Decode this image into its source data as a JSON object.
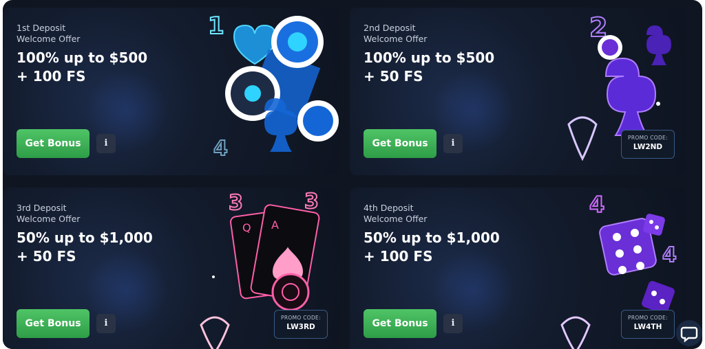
{
  "cards": [
    {
      "subtitle_line1": "1st Deposit",
      "subtitle_line2": "Welcome Offer",
      "offer_line1": "100% up to $500",
      "offer_line2": "+ 100 FS",
      "button": "Get Bonus",
      "info": "i"
    },
    {
      "subtitle_line1": "2nd Deposit",
      "subtitle_line2": "Welcome Offer",
      "offer_line1": "100% up to $500",
      "offer_line2": "+ 50 FS",
      "button": "Get Bonus",
      "info": "i",
      "promo_label": "PROMO CODE:",
      "promo_code": "LW2ND"
    },
    {
      "subtitle_line1": "3rd Deposit",
      "subtitle_line2": "Welcome Offer",
      "offer_line1": "50% up to $1,000",
      "offer_line2": "+ 50 FS",
      "button": "Get Bonus",
      "info": "i",
      "promo_label": "PROMO CODE:",
      "promo_code": "LW3RD"
    },
    {
      "subtitle_line1": "4th Deposit",
      "subtitle_line2": "Welcome Offer",
      "offer_line1": "50% up to $1,000",
      "offer_line2": "+ 100 FS",
      "button": "Get Bonus",
      "info": "i",
      "promo_label": "PROMO CODE:",
      "promo_code": "LW4TH"
    }
  ],
  "icons": {
    "card1_art": "casino-chips-hearts-clubs-icon",
    "card2_art": "neon-club-chips-icon",
    "card3_art": "playing-cards-ace-queen-icon",
    "card4_art": "neon-dice-icon",
    "chat": "chat-bubble-icon"
  },
  "colors": {
    "background": "#0f1622",
    "card": "#131c2d",
    "button_green": "#3fb35a",
    "promo_border": "#3a5a86",
    "neon_blue": "#2fd3ff",
    "neon_purple": "#9b5cff",
    "neon_pink": "#ff5fa8"
  }
}
